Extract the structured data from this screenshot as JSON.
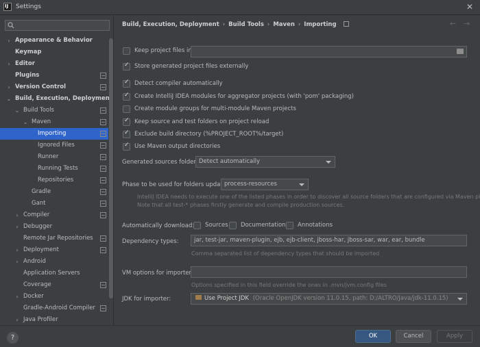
{
  "window": {
    "title": "Settings"
  },
  "search": {
    "placeholder": ""
  },
  "tree": [
    {
      "label": "Appearance & Behavior",
      "bold": true,
      "arrow": "›",
      "level": 0,
      "icon": false
    },
    {
      "label": "Keymap",
      "bold": true,
      "arrow": "",
      "level": 0,
      "icon": false
    },
    {
      "label": "Editor",
      "bold": true,
      "arrow": "›",
      "level": 0,
      "icon": false
    },
    {
      "label": "Plugins",
      "bold": true,
      "arrow": "",
      "level": 0,
      "icon": true
    },
    {
      "label": "Version Control",
      "bold": true,
      "arrow": "›",
      "level": 0,
      "icon": true
    },
    {
      "label": "Build, Execution, Deployment",
      "bold": true,
      "arrow": "⌄",
      "level": 0,
      "icon": false
    },
    {
      "label": "Build Tools",
      "bold": false,
      "arrow": "⌄",
      "level": 1,
      "icon": true
    },
    {
      "label": "Maven",
      "bold": false,
      "arrow": "⌄",
      "level": 2,
      "icon": true
    },
    {
      "label": "Importing",
      "bold": false,
      "arrow": "",
      "level": 3,
      "icon": true,
      "selected": true
    },
    {
      "label": "Ignored Files",
      "bold": false,
      "arrow": "",
      "level": 3,
      "icon": true
    },
    {
      "label": "Runner",
      "bold": false,
      "arrow": "",
      "level": 3,
      "icon": true
    },
    {
      "label": "Running Tests",
      "bold": false,
      "arrow": "",
      "level": 3,
      "icon": true
    },
    {
      "label": "Repositories",
      "bold": false,
      "arrow": "",
      "level": 3,
      "icon": true
    },
    {
      "label": "Gradle",
      "bold": false,
      "arrow": "",
      "level": 2,
      "icon": true
    },
    {
      "label": "Gant",
      "bold": false,
      "arrow": "",
      "level": 2,
      "icon": true
    },
    {
      "label": "Compiler",
      "bold": false,
      "arrow": "›",
      "level": 1,
      "icon": true
    },
    {
      "label": "Debugger",
      "bold": false,
      "arrow": "›",
      "level": 1,
      "icon": false
    },
    {
      "label": "Remote Jar Repositories",
      "bold": false,
      "arrow": "",
      "level": 1,
      "icon": true
    },
    {
      "label": "Deployment",
      "bold": false,
      "arrow": "›",
      "level": 1,
      "icon": true
    },
    {
      "label": "Android",
      "bold": false,
      "arrow": "›",
      "level": 1,
      "icon": false
    },
    {
      "label": "Application Servers",
      "bold": false,
      "arrow": "",
      "level": 1,
      "icon": false
    },
    {
      "label": "Coverage",
      "bold": false,
      "arrow": "",
      "level": 1,
      "icon": true
    },
    {
      "label": "Docker",
      "bold": false,
      "arrow": "›",
      "level": 1,
      "icon": false
    },
    {
      "label": "Gradle-Android Compiler",
      "bold": false,
      "arrow": "",
      "level": 1,
      "icon": true
    },
    {
      "label": "Java Profiler",
      "bold": false,
      "arrow": "›",
      "level": 1,
      "icon": false
    }
  ],
  "breadcrumb": [
    "Build, Execution, Deployment",
    "Build Tools",
    "Maven",
    "Importing"
  ],
  "options": {
    "keep_project_files": {
      "label": "Keep project files in:",
      "checked": false
    },
    "store_externally": {
      "label": "Store generated project files externally",
      "checked": true
    },
    "detect_compiler": {
      "label": "Detect compiler automatically",
      "checked": true
    },
    "create_modules": {
      "label": "Create IntelliJ IDEA modules for aggregator projects (with 'pom' packaging)",
      "checked": true
    },
    "module_groups": {
      "label": "Create module groups for multi-module Maven projects",
      "checked": false
    },
    "keep_source": {
      "label": "Keep source and test folders on project reload",
      "checked": true
    },
    "exclude_build": {
      "label": "Exclude build directory (%PROJECT_ROOT%/target)",
      "checked": true
    },
    "maven_output": {
      "label": "Use Maven output directories",
      "checked": true
    }
  },
  "generated_sources": {
    "label": "Generated sources folders:",
    "value": "Detect automatically"
  },
  "phase": {
    "label": "Phase to be used for folders update:",
    "value": "process-resources",
    "hint1": "IntelliJ IDEA needs to execute one of the listed phases in order to discover all source folders that are configured via Maven plugins.",
    "hint2": "Note that all test-* phases firstly generate and compile production sources."
  },
  "auto_download": {
    "label": "Automatically download:",
    "sources": "Sources",
    "documentation": "Documentation",
    "annotations": "Annotations"
  },
  "dependency_types": {
    "label": "Dependency types:",
    "value": "jar, test-jar, maven-plugin, ejb, ejb-client, jboss-har, jboss-sar, war, ear, bundle",
    "hint": "Comma separated list of dependency types that should be imported"
  },
  "vm_options": {
    "label": "VM options for importer:",
    "value": "",
    "hint": "Options specified in this field override the ones in .mvn/jvm.config files"
  },
  "jdk": {
    "label": "JDK for importer:",
    "value": "Use Project JDK",
    "detail": "(Oracle OpenJDK version 11.0.15, path: D:/ALTRO/Java/jdk-11.0.15)"
  },
  "footer": {
    "help": "?",
    "ok": "OK",
    "cancel": "Cancel",
    "apply": "Apply"
  },
  "colors": {
    "accent": "#2f65ca",
    "primary_button": "#365880",
    "background": "#3c3f41"
  }
}
